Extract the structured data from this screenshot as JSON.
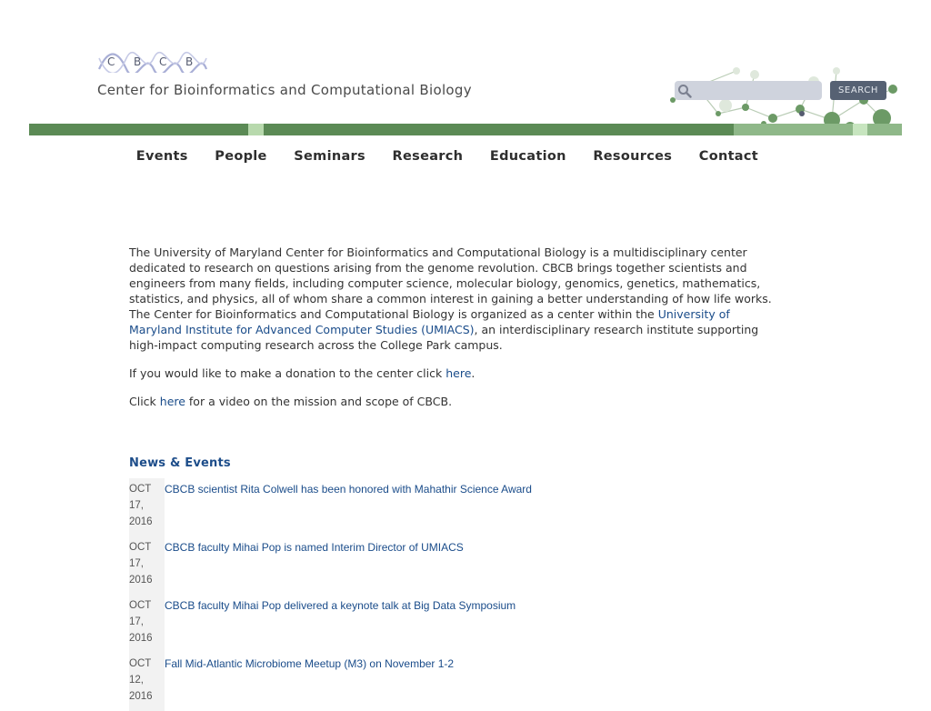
{
  "header": {
    "logo_letters": [
      "C",
      "B",
      "C",
      "B"
    ],
    "tagline": "Center for Bioinformatics and Computational Biology",
    "search": {
      "placeholder": "",
      "value": "",
      "button_label": "SEARCH",
      "icon": "search-icon"
    }
  },
  "colors": {
    "band_green": "#5b8a55",
    "band_light": "#b8d9ad",
    "link_blue": "#1a4c8a",
    "search_button_bg": "#566173",
    "search_field_bg": "#cfd3dd"
  },
  "nav": {
    "items": [
      "Events",
      "People",
      "Seminars",
      "Research",
      "Education",
      "Resources",
      "Contact"
    ]
  },
  "intro": {
    "text_before_link": "The University of Maryland Center for Bioinformatics and Computational Biology is a multidisciplinary center dedicated to research on questions arising from the genome revolution. CBCB brings together scientists and engineers from many fields, including computer science, molecular biology, genomics, genetics, mathematics, statistics, and physics, all of whom share a common interest in gaining a better understanding of how life works. The Center for Bioinformatics and Computational Biology is organized as a center within the ",
    "umiacs_link": "University of Maryland Institute for Advanced Computer Studies (UMIACS)",
    "text_after_link": ", an interdisciplinary research institute supporting high-impact computing research across the College Park campus.",
    "donation_before": "If you would like to make a donation to the center click ",
    "donation_link": "here",
    "donation_after": ".",
    "video_before": "Click ",
    "video_link": "here",
    "video_after": " for a video on the mission and scope of CBCB."
  },
  "news": {
    "heading": "News & Events",
    "items": [
      {
        "month": "OCT",
        "day": "17,",
        "year": "2016",
        "title": "CBCB scientist Rita Colwell has been honored with Mahathir Science Award"
      },
      {
        "month": "OCT",
        "day": "17,",
        "year": "2016",
        "title": "CBCB faculty Mihai Pop is named Interim Director of UMIACS"
      },
      {
        "month": "OCT",
        "day": "17,",
        "year": "2016",
        "title": "CBCB faculty Mihai Pop delivered a keynote talk at Big Data Symposium"
      },
      {
        "month": "OCT",
        "day": "12,",
        "year": "2016",
        "title": "Fall Mid-Atlantic Microbiome Meetup (M3) on November 1-2"
      }
    ]
  }
}
